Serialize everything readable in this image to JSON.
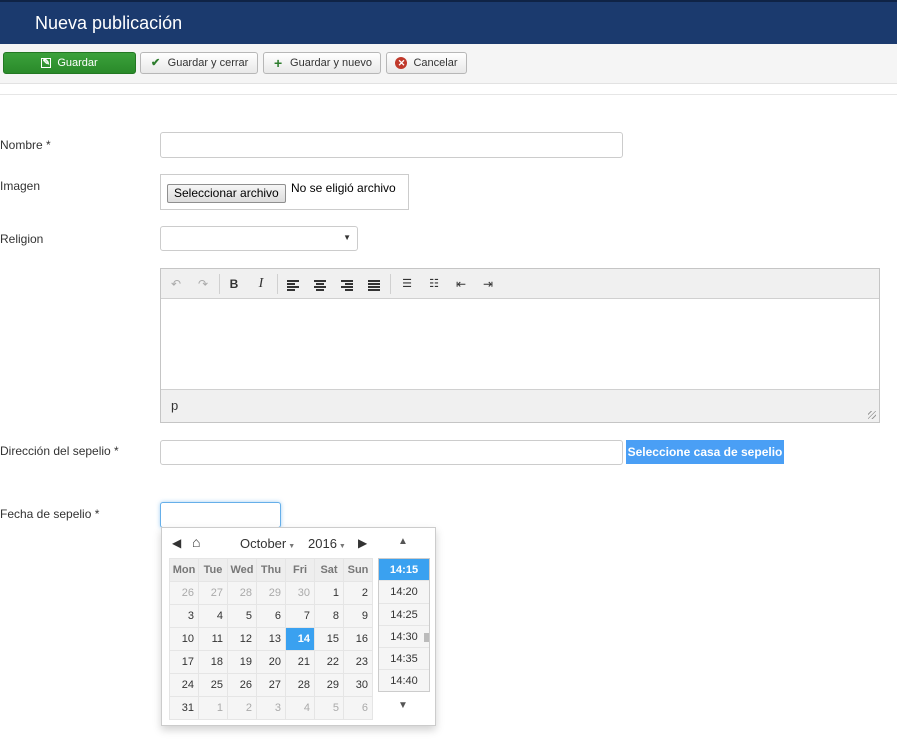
{
  "header": {
    "title": "Nueva publicación"
  },
  "toolbar": {
    "save_label": "Guardar",
    "save_close_label": "Guardar y cerrar",
    "save_new_label": "Guardar y nuevo",
    "cancel_label": "Cancelar"
  },
  "form": {
    "nombre_label": "Nombre *",
    "imagen_label": "Imagen",
    "file_button_label": "Seleccionar archivo",
    "file_status": "No se eligió archivo",
    "religion_label": "Religion",
    "editor_path": "p",
    "direccion_label": "Dirección del sepelio *",
    "casa_button_label": "Seleccione casa de sepelio",
    "fecha_label": "Fecha de sepelio *"
  },
  "datepicker": {
    "month": "October",
    "year": "2016",
    "weekdays": [
      "Mon",
      "Tue",
      "Wed",
      "Thu",
      "Fri",
      "Sat",
      "Sun"
    ],
    "weeks": [
      [
        "26",
        "27",
        "28",
        "29",
        "30",
        "1",
        "2"
      ],
      [
        "3",
        "4",
        "5",
        "6",
        "7",
        "8",
        "9"
      ],
      [
        "10",
        "11",
        "12",
        "13",
        "14",
        "15",
        "16"
      ],
      [
        "17",
        "18",
        "19",
        "20",
        "21",
        "22",
        "23"
      ],
      [
        "24",
        "25",
        "26",
        "27",
        "28",
        "29",
        "30"
      ],
      [
        "31",
        "1",
        "2",
        "3",
        "4",
        "5",
        "6"
      ]
    ],
    "selected_day": "14",
    "times": [
      "14:15",
      "14:20",
      "14:25",
      "14:30",
      "14:35",
      "14:40"
    ],
    "selected_time": "14:15"
  },
  "colors": {
    "header_bg": "#1b3a6e",
    "save_green": "#2a8a2a",
    "accent_blue": "#3aa1f0",
    "casa_button_bg": "#4a9ff5"
  }
}
